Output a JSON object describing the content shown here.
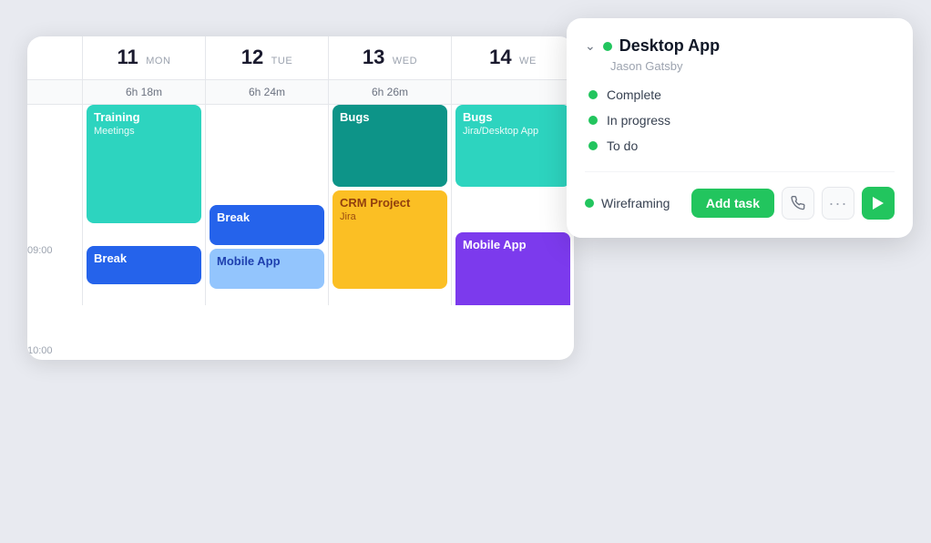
{
  "calendar": {
    "days": [
      {
        "num": "11",
        "name": "MON",
        "hours": "6h 18m"
      },
      {
        "num": "12",
        "name": "TUE",
        "hours": "6h 24m"
      },
      {
        "num": "13",
        "name": "WED",
        "hours": "6h 26m"
      },
      {
        "num": "14",
        "name": "WE",
        "hours": ""
      }
    ],
    "times": [
      "09:00",
      "10:00"
    ],
    "events": {
      "mon": [
        {
          "id": "training",
          "title": "Training",
          "sub": "Meetings",
          "color": "#2dd4bf"
        },
        {
          "id": "break-mon",
          "title": "Break",
          "color": "#2563eb"
        }
      ],
      "tue": [
        {
          "id": "break-tue",
          "title": "Break",
          "color": "#2563eb"
        },
        {
          "id": "mobile-app",
          "title": "Mobile App",
          "color": "#93c5fd"
        }
      ],
      "wed": [
        {
          "id": "bugs-wed",
          "title": "Bugs",
          "color": "#0d9488"
        },
        {
          "id": "crm",
          "title": "CRM Project",
          "sub": "Jira",
          "color": "#fbbf24"
        }
      ],
      "thu": [
        {
          "id": "bugs-thu",
          "title": "Bugs",
          "sub": "Jira/Desktop App",
          "color": "#2dd4bf"
        },
        {
          "id": "mobile-thu",
          "title": "Mobile App",
          "color": "#7c3aed"
        }
      ]
    }
  },
  "popup": {
    "title": "Desktop App",
    "subtitle": "Jason Gatsby",
    "statuses": [
      {
        "label": "Complete",
        "color": "#22c55e"
      },
      {
        "label": "In progress",
        "color": "#22c55e"
      },
      {
        "label": "To do",
        "color": "#22c55e"
      }
    ],
    "footer": {
      "dot_color": "#22c55e",
      "wireframing_label": "Wireframing",
      "add_task_label": "Add task",
      "icons": {
        "phone": "📞",
        "more": "···",
        "play": "▶"
      }
    }
  }
}
